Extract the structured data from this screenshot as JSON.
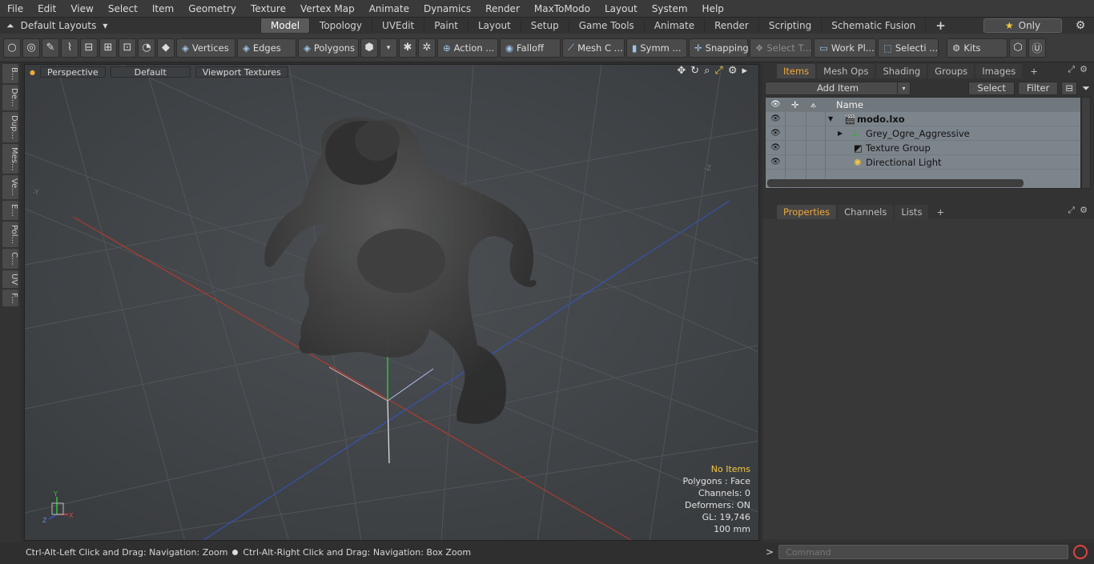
{
  "menu": [
    "File",
    "Edit",
    "View",
    "Select",
    "Item",
    "Geometry",
    "Texture",
    "Vertex Map",
    "Animate",
    "Dynamics",
    "Render",
    "MaxToModo",
    "Layout",
    "System",
    "Help"
  ],
  "layout_selector": "Default Layouts",
  "mode_tabs": [
    "Model",
    "Topology",
    "UVEdit",
    "Paint",
    "Layout",
    "Setup",
    "Game Tools",
    "Animate",
    "Render",
    "Scripting",
    "Schematic Fusion"
  ],
  "active_mode_tab": "Model",
  "only_button": "Only",
  "toolbar": {
    "vertices": "Vertices",
    "edges": "Edges",
    "polygons": "Polygons",
    "action": "Action ...",
    "falloff": "Falloff",
    "meshc": "Mesh C ...",
    "symm": "Symm ...",
    "snapping": "Snapping",
    "selectt": "Select T...",
    "workpl": "Work Pl...",
    "selecti": "Selecti ...",
    "kits": "Kits"
  },
  "left_tabs": [
    "B...",
    "De...",
    "Dup...",
    "Mes...",
    "Ve...",
    "E...",
    "Pol...",
    "C...",
    "UV",
    "F..."
  ],
  "viewport": {
    "view": "Perspective",
    "shading": "Default",
    "textures": "Viewport Textures",
    "stats": {
      "items": "No Items",
      "polygons": "Polygons : Face",
      "channels": "Channels: 0",
      "deformers": "Deformers: ON",
      "gl": "GL: 19,746",
      "scale": "100 mm"
    }
  },
  "status": {
    "left": "Ctrl-Alt-Left Click and Drag: Navigation: Zoom",
    "right": "Ctrl-Alt-Right Click and Drag: Navigation: Box Zoom"
  },
  "items_panel": {
    "tabs": [
      "Items",
      "Mesh Ops",
      "Shading",
      "Groups",
      "Images"
    ],
    "active_tab": "Items",
    "add_item": "Add Item",
    "select": "Select",
    "filter": "Filter",
    "column_name": "Name",
    "rows": [
      {
        "name": "modo.lxo",
        "indent": 0
      },
      {
        "name": "Grey_Ogre_Aggressive",
        "indent": 1
      },
      {
        "name": "Texture Group",
        "indent": 1
      },
      {
        "name": "Directional Light",
        "indent": 1
      }
    ]
  },
  "props_panel": {
    "tabs": [
      "Properties",
      "Channels",
      "Lists"
    ],
    "active_tab": "Properties"
  },
  "command": {
    "placeholder": "Command"
  },
  "colors": {
    "accent": "#f2a83a",
    "grid_red": "#c0392b",
    "grid_blue": "#3356c8",
    "axis_green": "#2ec43e"
  }
}
